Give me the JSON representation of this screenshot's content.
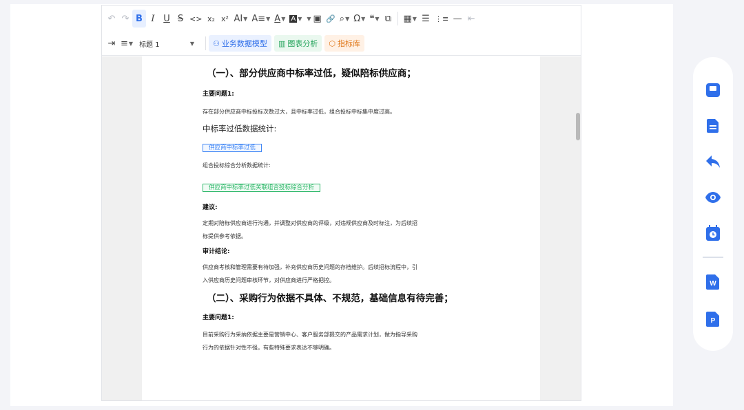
{
  "toolbar": {
    "undo": "↶",
    "redo": "↷",
    "bold": "B",
    "italic": "I",
    "underline": "U",
    "strike": "S",
    "code": "<>",
    "subscript": "x₂",
    "superscript": "x²",
    "font_size": "AI",
    "line_height": "A≡",
    "font_color": "A",
    "bg_color": "A",
    "image": "▣",
    "link": "🔗",
    "search": "⌕",
    "special_char": "Ω",
    "quote": "❝",
    "template": "⧉",
    "table": "▦",
    "bullet_list": "☰",
    "ordered_list": "⋮≡",
    "hr": "—",
    "outdent": "⇤",
    "indent": "⇥",
    "align": "≡",
    "heading_value": "标题 1",
    "chip_model": "业务数据模型",
    "chip_chart": "图表分析",
    "chip_index": "指标库"
  },
  "doc": {
    "h1": "（一）、部分供应商中标率过低，疑似陪标供应商；",
    "label1": "主要问题1:",
    "p1": "存在部分供应商中标投标次数过大，且中标率过低，组合投标中标集中度过高。",
    "sub1": "中标率过低数据统计:",
    "tag1": "供应商中标率过低",
    "p2": "组合投标综合分析数据统计:",
    "tag2": "供应商中标率过低关联组合投标综合分析",
    "label2": "建议:",
    "p3a": "定期对陪标供应商进行沟通，并调整对供应商的评级，对违规供应商及时标注，为后续招",
    "p3b": "标提供参考依据。",
    "label3": "审计结论:",
    "p4a": "供应商考核和管理需要有待加强，补充供应商历史问题的存档维护。后续招标流程中，引",
    "p4b": "入供应商历史问题审核环节，对供应商进行严格把控。",
    "h2": "（二）、采购行为依据不具体、不规范，基础信息有待完善；",
    "label4": "主要问题1:",
    "p5a": "目前采购行为采纳依据主要是营销中心、客户服务部提交的产品需求计划，做为指导采购",
    "p5b": "行为的依据针对性不强，有些特殊要求表达不够明确。"
  },
  "sidebar": {
    "accent": "#2f6fea",
    "icons": [
      "save-icon",
      "save-as-icon",
      "return-icon",
      "preview-icon",
      "schedule-icon",
      "export-word-icon",
      "export-pdf-icon"
    ],
    "word_letter": "W",
    "pdf_letter": "P"
  }
}
